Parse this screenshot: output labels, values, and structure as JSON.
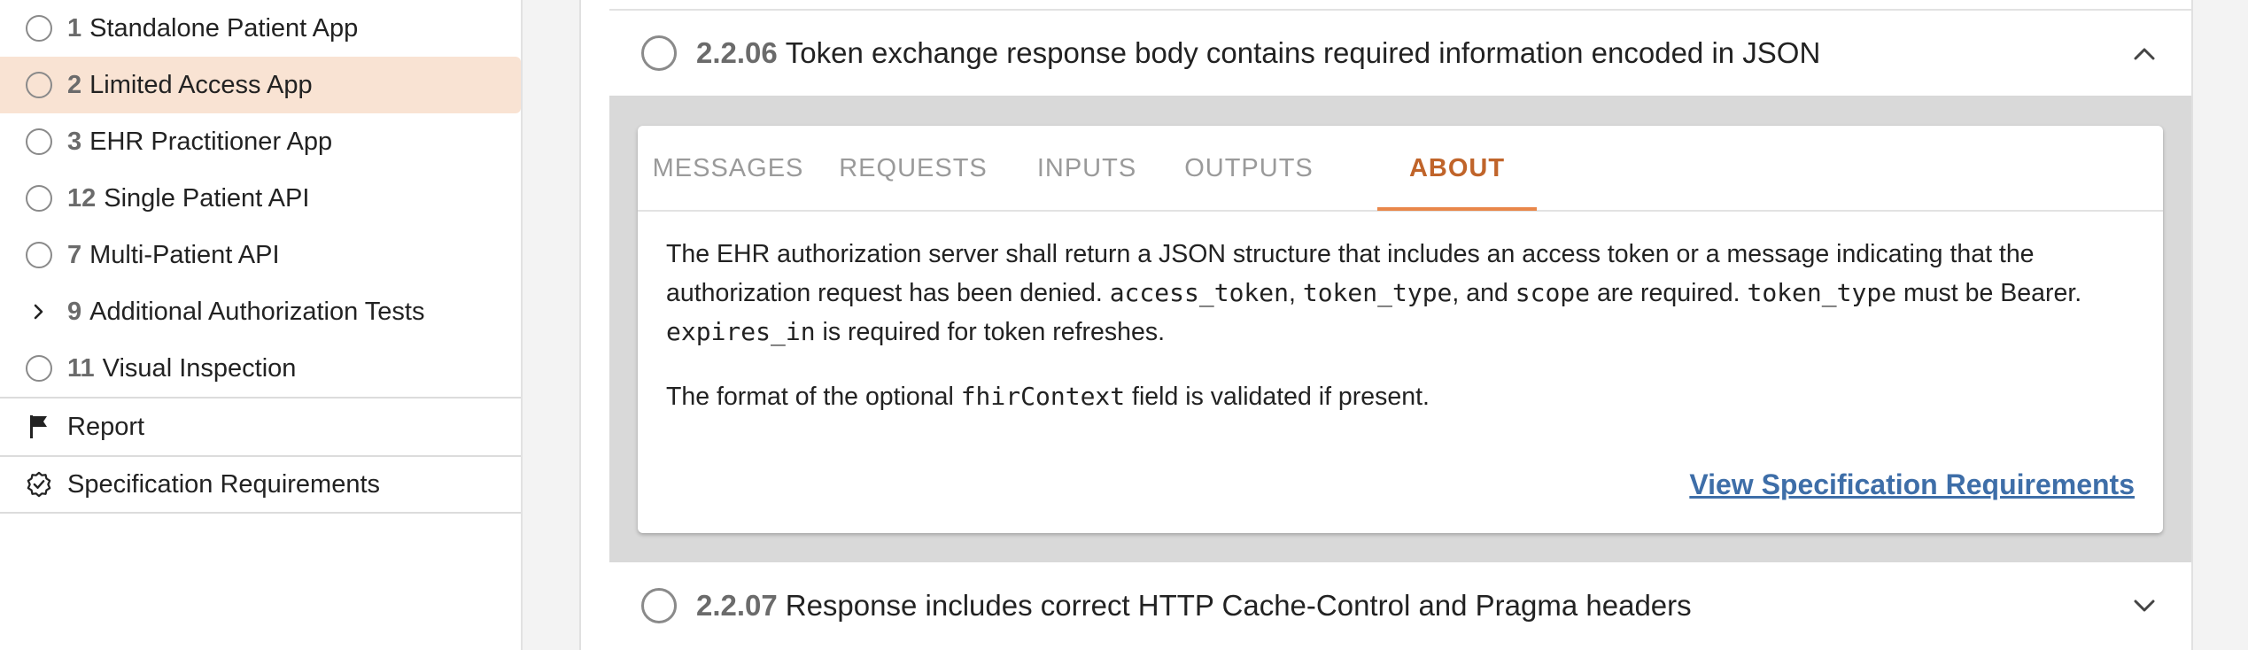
{
  "sidebar": {
    "items": [
      {
        "num": "1",
        "label": "Standalone Patient App",
        "selected": false,
        "kind": "radio"
      },
      {
        "num": "2",
        "label": "Limited Access App",
        "selected": true,
        "kind": "radio"
      },
      {
        "num": "3",
        "label": "EHR Practitioner App",
        "selected": false,
        "kind": "radio"
      },
      {
        "num": "12",
        "label": "Single Patient API",
        "selected": false,
        "kind": "radio"
      },
      {
        "num": "7",
        "label": "Multi-Patient API",
        "selected": false,
        "kind": "radio"
      },
      {
        "num": "9",
        "label": "Additional Authorization Tests",
        "selected": false,
        "kind": "chevron"
      },
      {
        "num": "11",
        "label": "Visual Inspection",
        "selected": false,
        "kind": "radio"
      }
    ],
    "links": [
      {
        "label": "Report",
        "icon": "flag-icon"
      },
      {
        "label": "Specification Requirements",
        "icon": "verified-badge-icon"
      }
    ],
    "selected_color": "#f9e3d3"
  },
  "tests": {
    "expanded": {
      "id": "2.2.06",
      "title": "Token exchange response body contains required information encoded in JSON",
      "tabs": [
        "MESSAGES",
        "REQUESTS",
        "INPUTS",
        "OUTPUTS",
        "ABOUT"
      ],
      "active_tab": "ABOUT",
      "about": {
        "p1_a": "The EHR authorization server shall return a JSON structure that includes an access token or a message indicating that the authorization request has been denied. ",
        "p1_code1": "access_token",
        "p1_sep1": ", ",
        "p1_code2": "token_type",
        "p1_sep2": ", and ",
        "p1_code3": "scope",
        "p1_b": " are required. ",
        "p1_code4": "token_type",
        "p1_c": " must be Bearer. ",
        "p1_code5": "expires_in",
        "p1_d": " is required for token refreshes.",
        "p2_a": "The format of the optional ",
        "p2_code": "fhirContext",
        "p2_b": " field is validated if present."
      },
      "spec_link": "View Specification Requirements"
    },
    "next": {
      "id": "2.2.07",
      "title": "Response includes correct HTTP Cache-Control and Pragma headers"
    }
  },
  "colors": {
    "accent": "#c0642a",
    "tab_underline": "#e9874a",
    "link": "#3e6ea8"
  }
}
